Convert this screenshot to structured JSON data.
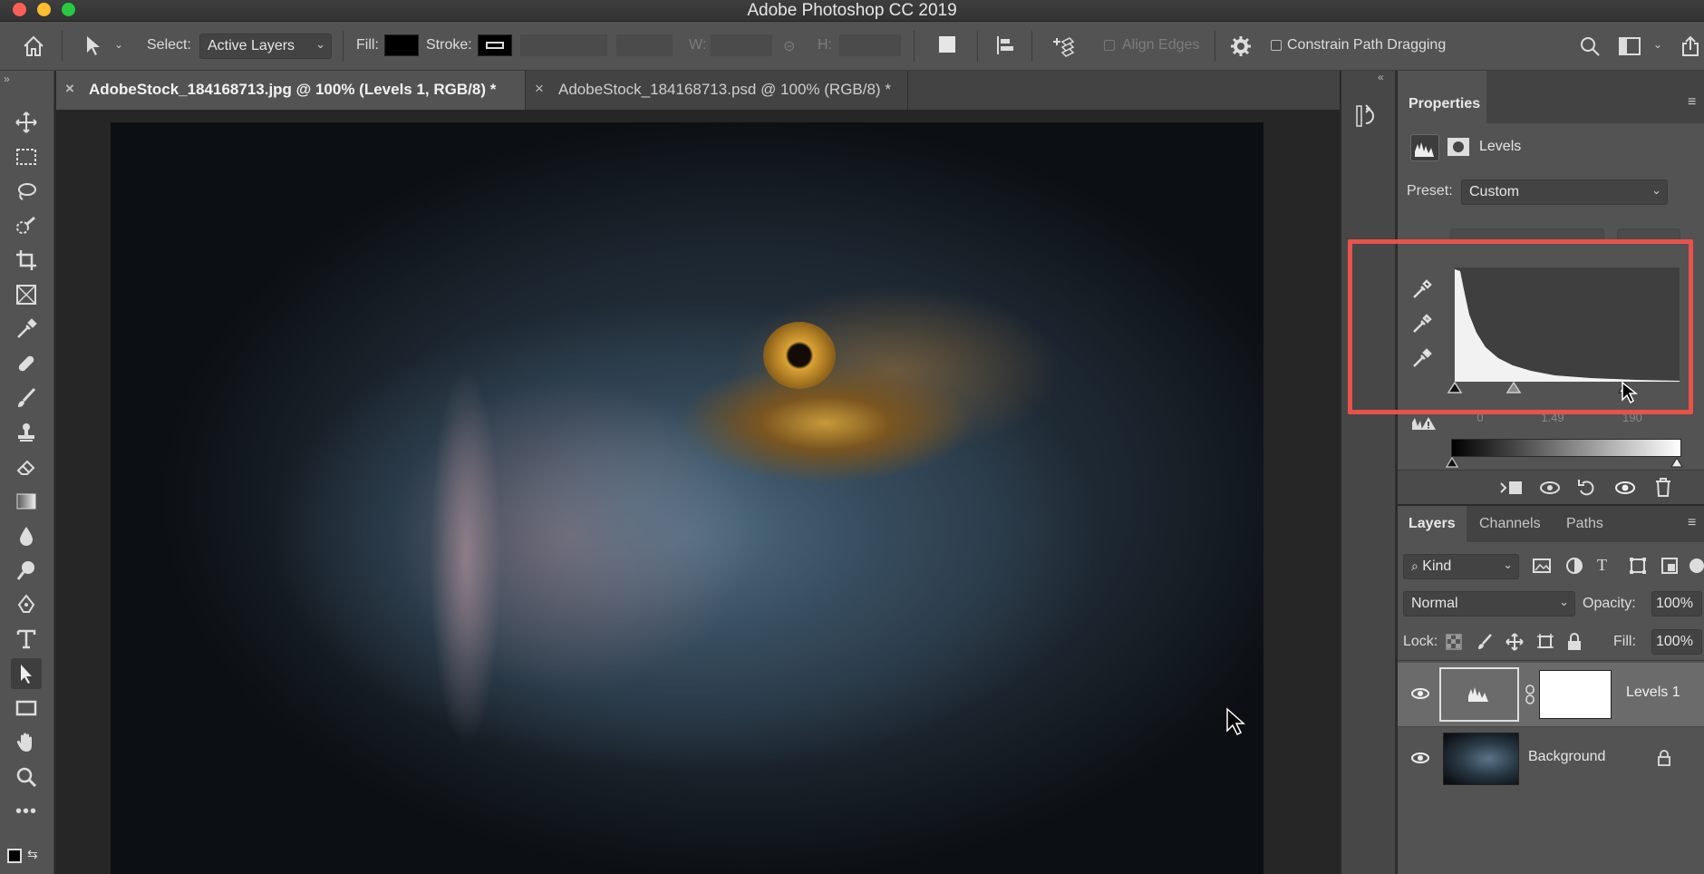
{
  "app": {
    "title": "Adobe Photoshop CC 2019"
  },
  "options_bar": {
    "select_label": "Select:",
    "select_value": "Active Layers",
    "fill_label": "Fill:",
    "stroke_label": "Stroke:",
    "w_label": "W:",
    "h_label": "H:",
    "align_edges": "Align Edges",
    "constrain": "Constrain Path Dragging"
  },
  "tabs": [
    {
      "label": "AdobeStock_184168713.jpg @ 100% (Levels 1, RGB/8) *",
      "active": true
    },
    {
      "label": "AdobeStock_184168713.psd @ 100% (RGB/8) *",
      "active": false
    }
  ],
  "properties": {
    "tab": "Properties",
    "adjustment": "Levels",
    "preset_label": "Preset:",
    "preset_value": "Custom",
    "input_low": "0",
    "input_mid": "1.49",
    "input_high": "190"
  },
  "layers_panel": {
    "tabs": [
      "Layers",
      "Channels",
      "Paths"
    ],
    "kind_label": "Kind",
    "blend_mode": "Normal",
    "opacity_label": "Opacity:",
    "opacity_value": "100%",
    "lock_label": "Lock:",
    "fill_label": "Fill:",
    "fill_value": "100%",
    "layers": [
      {
        "name": "Levels 1",
        "visible": true,
        "selected": true
      },
      {
        "name": "Background",
        "visible": true,
        "locked": true
      }
    ]
  },
  "colors": {
    "accent_frame": "#e8524a",
    "panel": "#535353",
    "canvas": "#262626"
  }
}
